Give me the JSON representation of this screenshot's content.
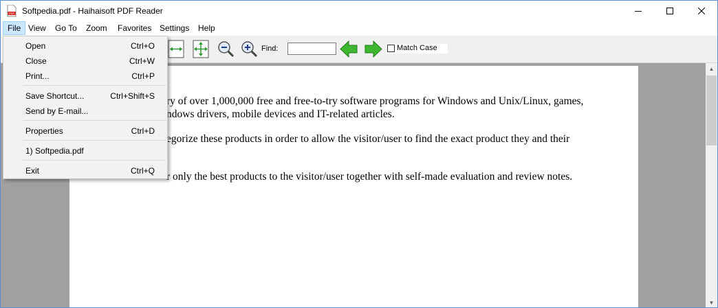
{
  "window": {
    "title": "Softpedia.pdf - Haihaisoft PDF Reader"
  },
  "menubar": {
    "items": [
      "File",
      "View",
      "Go To",
      "Zoom",
      "Favorites",
      "Settings",
      "Help"
    ]
  },
  "toolbar": {
    "find_label": "Find:",
    "find_value": "",
    "match_case_label": "Match Case",
    "icons": [
      "fit-width-icon",
      "fit-page-icon",
      "zoom-out-icon",
      "zoom-in-icon",
      "find-previous-arrow-icon",
      "find-next-arrow-icon"
    ]
  },
  "file_menu": {
    "open": {
      "label": "Open",
      "shortcut": "Ctrl+O"
    },
    "close": {
      "label": "Close",
      "shortcut": "Ctrl+W"
    },
    "print": {
      "label": "Print...",
      "shortcut": "Ctrl+P"
    },
    "save_shortcut": {
      "label": "Save Shortcut...",
      "shortcut": "Ctrl+Shift+S"
    },
    "send_email": {
      "label": "Send by E-mail...",
      "shortcut": ""
    },
    "properties": {
      "label": "Properties",
      "shortcut": "Ctrl+D"
    },
    "recent_1": {
      "label": "1) Softpedia.pdf",
      "shortcut": ""
    },
    "exit": {
      "label": "Exit",
      "shortcut": "Ctrl+Q"
    }
  },
  "document": {
    "line1": "ry of over 1,000,000 free and free-to-try software programs for Windows and Unix/Linux, games,",
    "line2": "ndows drivers, mobile devices and IT-related articles.",
    "line3": "egorize these products in order to allow the visitor/user to find the exact product they and their",
    "line4": "r only the best products to the visitor/user together with self-made evaluation and review notes."
  },
  "colors": {
    "menu_highlight": "#cce8ff",
    "page_background": "#a0a0a0",
    "arrow_green": "#3fb62f"
  }
}
